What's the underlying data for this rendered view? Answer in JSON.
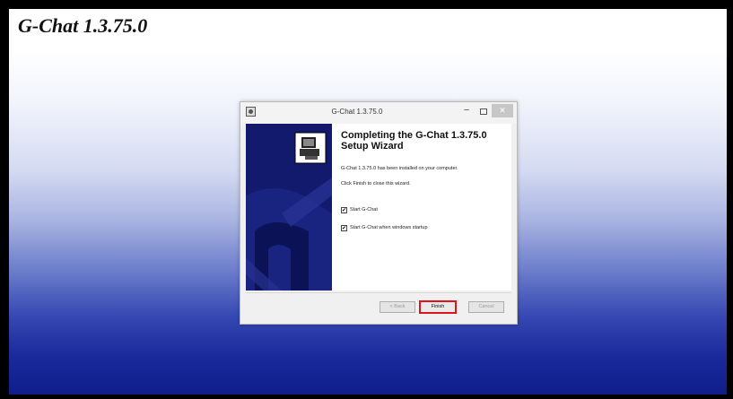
{
  "slide": {
    "title": "G-Chat 1.3.75.0"
  },
  "dialog": {
    "window_title": "G-Chat 1.3.75.0",
    "minimize_glyph": "–",
    "close_glyph": "✕",
    "heading_line1": "Completing the G-Chat 1.3.75.0",
    "heading_line2": "Setup Wizard",
    "installed_text": "G-Chat 1.3.75.0 has been installed on your computer.",
    "finish_hint": "Click Finish to close this wizard.",
    "checkboxes": [
      {
        "label": "Start G-Chat",
        "checked": true,
        "mark": "✔"
      },
      {
        "label": "Start G-Chat when windows startup",
        "checked": true,
        "mark": "✔"
      }
    ],
    "buttons": {
      "back": "< Back",
      "finish": "Finish",
      "cancel": "Cancel"
    },
    "highlight_color": "#e0121c",
    "banner_color": "#121a6e"
  }
}
